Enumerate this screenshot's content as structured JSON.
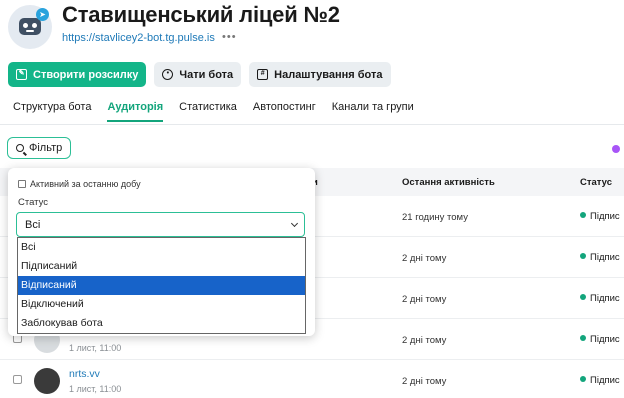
{
  "header": {
    "title": "Ставищенський ліцей №2",
    "url": "https://stavlicey2-bot.tg.pulse.is",
    "more": "•••"
  },
  "actions": [
    {
      "label": "Створити розсилку",
      "icon": "edit-icon"
    },
    {
      "label": "Чати бота",
      "icon": "chat-icon"
    },
    {
      "label": "Налаштування бота",
      "icon": "settings-icon"
    }
  ],
  "tabs": [
    {
      "label": "Структура бота",
      "active": false
    },
    {
      "label": "Аудиторія",
      "active": true
    },
    {
      "label": "Статистика",
      "active": false
    },
    {
      "label": "Автопостинг",
      "active": false
    },
    {
      "label": "Канали та групи",
      "active": false
    }
  ],
  "filter": {
    "button_label": "Фільтр",
    "active_day_label": "Активний за останню добу",
    "status_label": "Статус",
    "status_value": "Всі",
    "options": [
      "Всі",
      "Підписаний",
      "Відписаний",
      "Відключений",
      "Заблокував бота"
    ],
    "highlighted_option": "Відписаний"
  },
  "table": {
    "headers": {
      "user_partial": "и",
      "last_activity": "Остання активність",
      "status": "Статус"
    },
    "rows": [
      {
        "name": "",
        "sub": "",
        "last": "21 годину тому",
        "status": "Підпис"
      },
      {
        "name": "",
        "sub": "",
        "last": "2 дні тому",
        "status": "Підпис"
      },
      {
        "name": "",
        "sub": "",
        "last": "2 дні тому",
        "status": "Підпис"
      },
      {
        "name": "",
        "sub": "1 лист, 11:00",
        "last": "2 дні тому",
        "status": "Підпис"
      },
      {
        "name": "nrts.vv",
        "sub": "1 лист, 11:00",
        "last": "2 дні тому",
        "status": "Підпис"
      }
    ]
  },
  "colors": {
    "accent": "#13b589",
    "link": "#1f7ab8",
    "highlight": "#1763c9"
  }
}
